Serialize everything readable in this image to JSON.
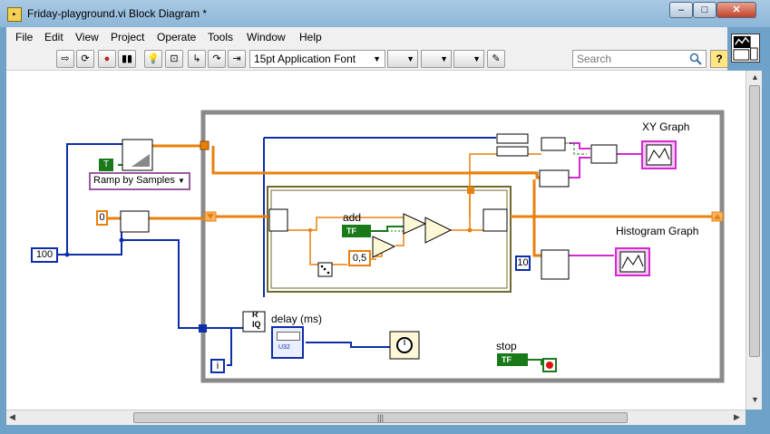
{
  "window": {
    "title": "Friday-playground.vi Block Diagram *",
    "minimize_glyph": "–",
    "maximize_glyph": "□",
    "close_glyph": "✕"
  },
  "menu": [
    "File",
    "Edit",
    "View",
    "Project",
    "Operate",
    "Tools",
    "Window",
    "Help"
  ],
  "toolbar": {
    "font_select": "15pt Application Font",
    "search_placeholder": "Search",
    "help_glyph": "?"
  },
  "diagram": {
    "constants": {
      "ramp_mode": "Ramp by Samples",
      "bool_true": "T",
      "zero": "0",
      "hundred": "100",
      "ten": "10",
      "half": "0,5",
      "loop_index": "i"
    },
    "labels": {
      "xy_graph": "XY Graph",
      "histogram_graph": "Histogram Graph",
      "add": "add",
      "delay": "delay (ms)",
      "stop": "stop"
    },
    "bool_tf": "TF",
    "divide_labels": {
      "r": "R",
      "iq": "IQ"
    },
    "u32": "U32"
  },
  "colors": {
    "wire_blue": "#0d2ea8",
    "wire_orange": "#e9800d",
    "wire_green": "#1a7a1a",
    "wire_pink": "#d32ad0",
    "loop_border": "#8a8a8a",
    "case_border": "#6e6a2e",
    "node_fill": "#fff8d6"
  },
  "icons": [
    "search-icon",
    "run-arrow-icon",
    "run-continuous-icon",
    "abort-icon",
    "pause-icon",
    "highlight-execution-icon",
    "retain-wire-values-icon",
    "step-into-icon",
    "step-over-icon",
    "step-out-icon",
    "align-icon",
    "distribute-icon",
    "reorder-icon",
    "cleanup-icon",
    "help-icon",
    "dice-icon",
    "wait-timer-icon",
    "stop-button-icon"
  ]
}
